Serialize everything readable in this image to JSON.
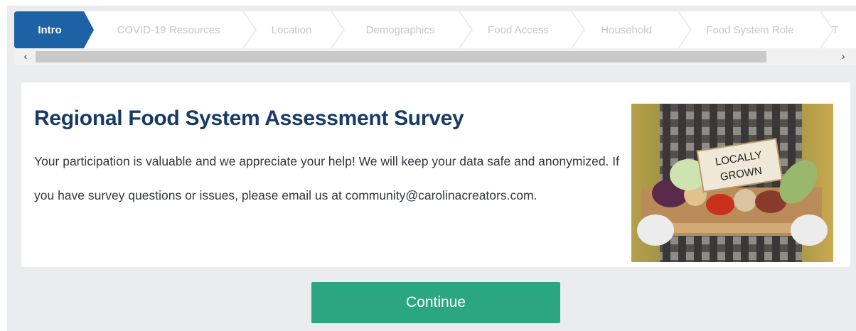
{
  "steps": [
    {
      "label": "Intro",
      "active": true
    },
    {
      "label": "COVID-19 Resources",
      "active": false
    },
    {
      "label": "Location",
      "active": false
    },
    {
      "label": "Demographics",
      "active": false
    },
    {
      "label": "Food Access",
      "active": false
    },
    {
      "label": "Household",
      "active": false
    },
    {
      "label": "Food System Role",
      "active": false
    },
    {
      "label": "T",
      "active": false
    }
  ],
  "scrollbar": {
    "left_arrow": "‹",
    "right_arrow": "›"
  },
  "card": {
    "title": "Regional Food System Assessment Survey",
    "paragraph": "Your participation is valuable and we appreciate your help! We will keep your data safe and anonymized. If you have survey questions or issues, please email us at community@carolinacreators.com.",
    "image_sign_text": "LOCALLY GROWN"
  },
  "continue_label": "Continue",
  "colors": {
    "accent": "#1c62a4",
    "title": "#173b66",
    "button": "#2aa780",
    "background": "#ebeced"
  }
}
